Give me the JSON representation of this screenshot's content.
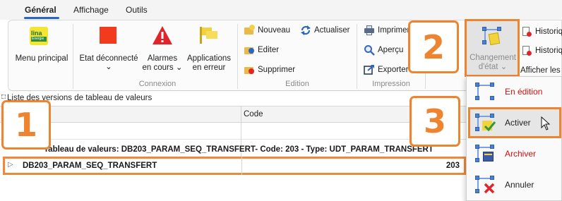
{
  "tabs": [
    {
      "label": "Général",
      "active": true
    },
    {
      "label": "Affichage",
      "active": false
    },
    {
      "label": "Outils",
      "active": false
    }
  ],
  "ribbon": {
    "menu_principal": {
      "label": "Menu principal",
      "logo_text": "lina",
      "logo_sub": "Energie"
    },
    "connexion": {
      "label": "Connexion",
      "etat": {
        "line1": "Etat déconnecté",
        "chevron": "⌄"
      },
      "alarmes": {
        "line1": "Alarmes",
        "line2": "en cours ⌄"
      },
      "applications": {
        "line1": "Applications",
        "line2": "en erreur"
      }
    },
    "edition": {
      "label": "Edition",
      "nouveau": "Nouveau",
      "actualiser": "Actualiser",
      "editer": "Editer",
      "supprimer": "Supprimer"
    },
    "impression": {
      "label": "Impression",
      "imprimer": "Imprimer",
      "apercu": "Aperçu",
      "exporter": "Exporter"
    },
    "changement": {
      "line1": "Changement",
      "line2": "d'état ⌄"
    },
    "historique1": "Historique",
    "historique2": "Historique",
    "afficher": "Afficher les v"
  },
  "list": {
    "title": "Liste des versions de tableau de valeurs",
    "columns": [
      "",
      "Code"
    ],
    "group_row": "Tableau de valeurs: DB203_PARAM_SEQ_TRANSFERT- Code: 203 - Type: UDT_PARAM_TRANSFERT",
    "rows": [
      {
        "name": "DB203_PARAM_SEQ_TRANSFERT",
        "code": "203"
      }
    ]
  },
  "dropdown": {
    "items": [
      {
        "label": "En édition",
        "color": "#c81414"
      },
      {
        "label": "Activer",
        "color": "#1f1f1f"
      },
      {
        "label": "Archiver",
        "color": "#c81414"
      },
      {
        "label": "Annuler",
        "color": "#1f1f1f"
      }
    ]
  },
  "callouts": [
    "1",
    "2",
    "3"
  ],
  "colors": {
    "accent": "#ef8430",
    "tab_underline": "#2a64c5",
    "alarm_red": "#e0252a",
    "state_red": "#f23a1c"
  }
}
